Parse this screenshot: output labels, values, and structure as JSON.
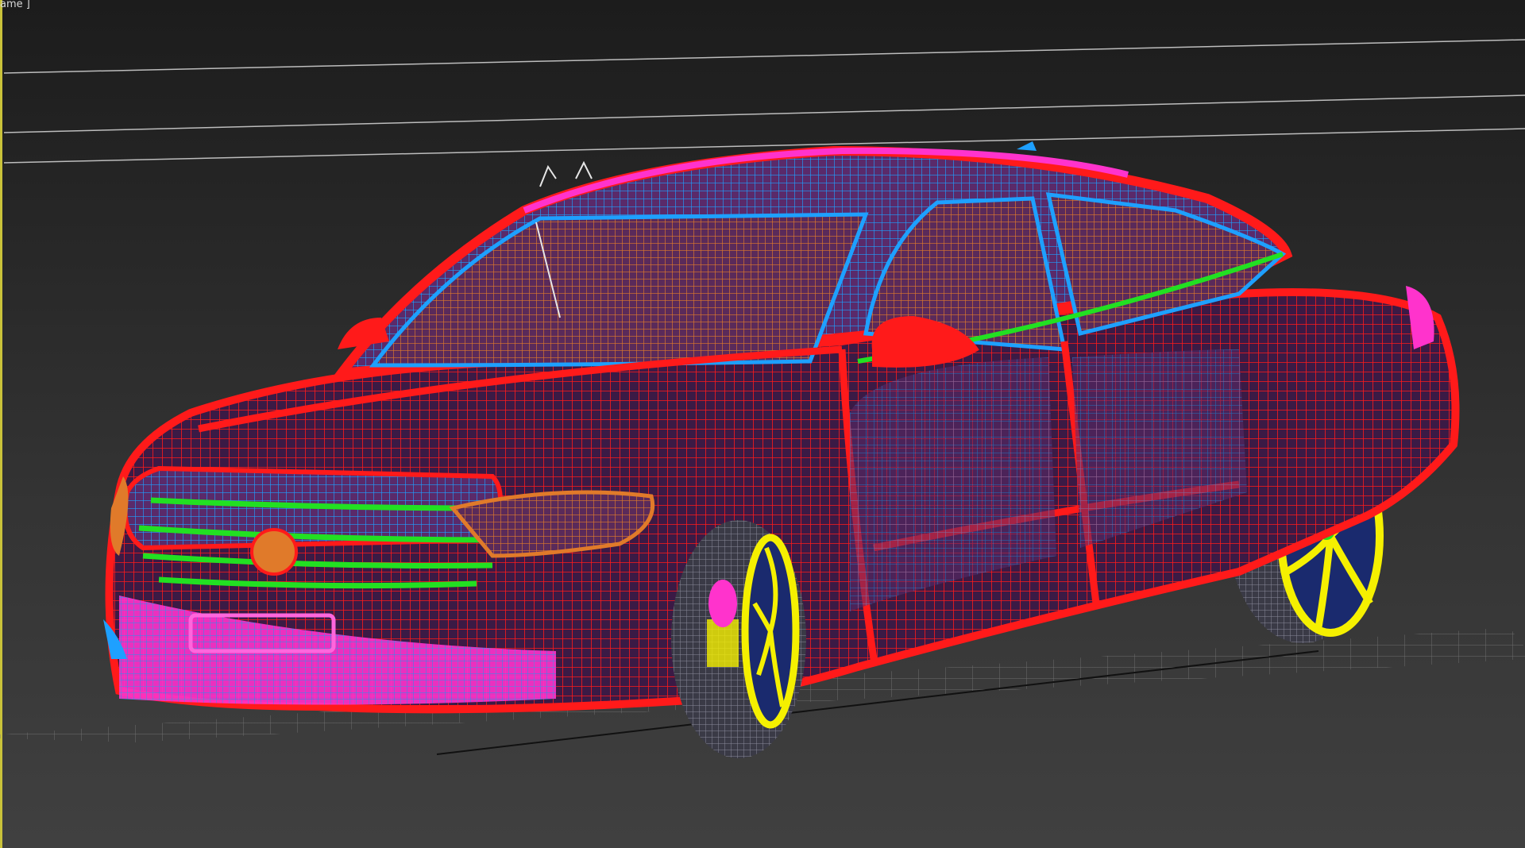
{
  "viewport": {
    "label": "ame ]",
    "border_color": "#c9c23a",
    "background_top": "#1c1c1c",
    "background_bottom": "#404040"
  },
  "model": {
    "icon": "car-wireframe-icon",
    "colors": {
      "body": "#ff1a1a",
      "glass": "#e07a2a",
      "interior": "#1ea0ff",
      "trim": "#ff33cc",
      "grille": "#22e022",
      "wheels": "#f5f000",
      "rims": "#1a2a6e",
      "grid": "#8a8a8a"
    }
  }
}
